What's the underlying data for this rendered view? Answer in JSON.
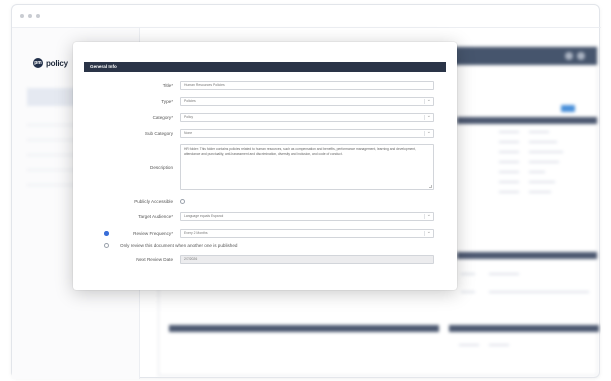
{
  "brand": {
    "name": "policy"
  },
  "dialog": {
    "title": "General Info",
    "fields": {
      "title": {
        "label": "Title*",
        "value": "Human Resources Policies"
      },
      "type": {
        "label": "Type*",
        "value": "Policies"
      },
      "category": {
        "label": "Category*",
        "value": "Policy"
      },
      "sub_category": {
        "label": "Sub Category",
        "value": "None"
      },
      "description": {
        "label": "Description",
        "value": "HR folder: This folder contains policies related to human resources, such as compensation and benefits, performance management, learning and development, attendance and punctuality, anti-harassment and discrimination, diversity and inclusion, and code of conduct."
      },
      "publicly_accessible": {
        "label": "Publicly Accessible"
      },
      "target_audience": {
        "label": "Target Audience*",
        "value": "Language equals Espanol"
      },
      "review_frequency": {
        "label": "Review Frequency*",
        "value": "Every 2 Months"
      },
      "review_option": {
        "label": "Only review this document when another one is published"
      },
      "next_review_date": {
        "label": "Next Review Date",
        "value": "2/7/2026"
      }
    }
  }
}
